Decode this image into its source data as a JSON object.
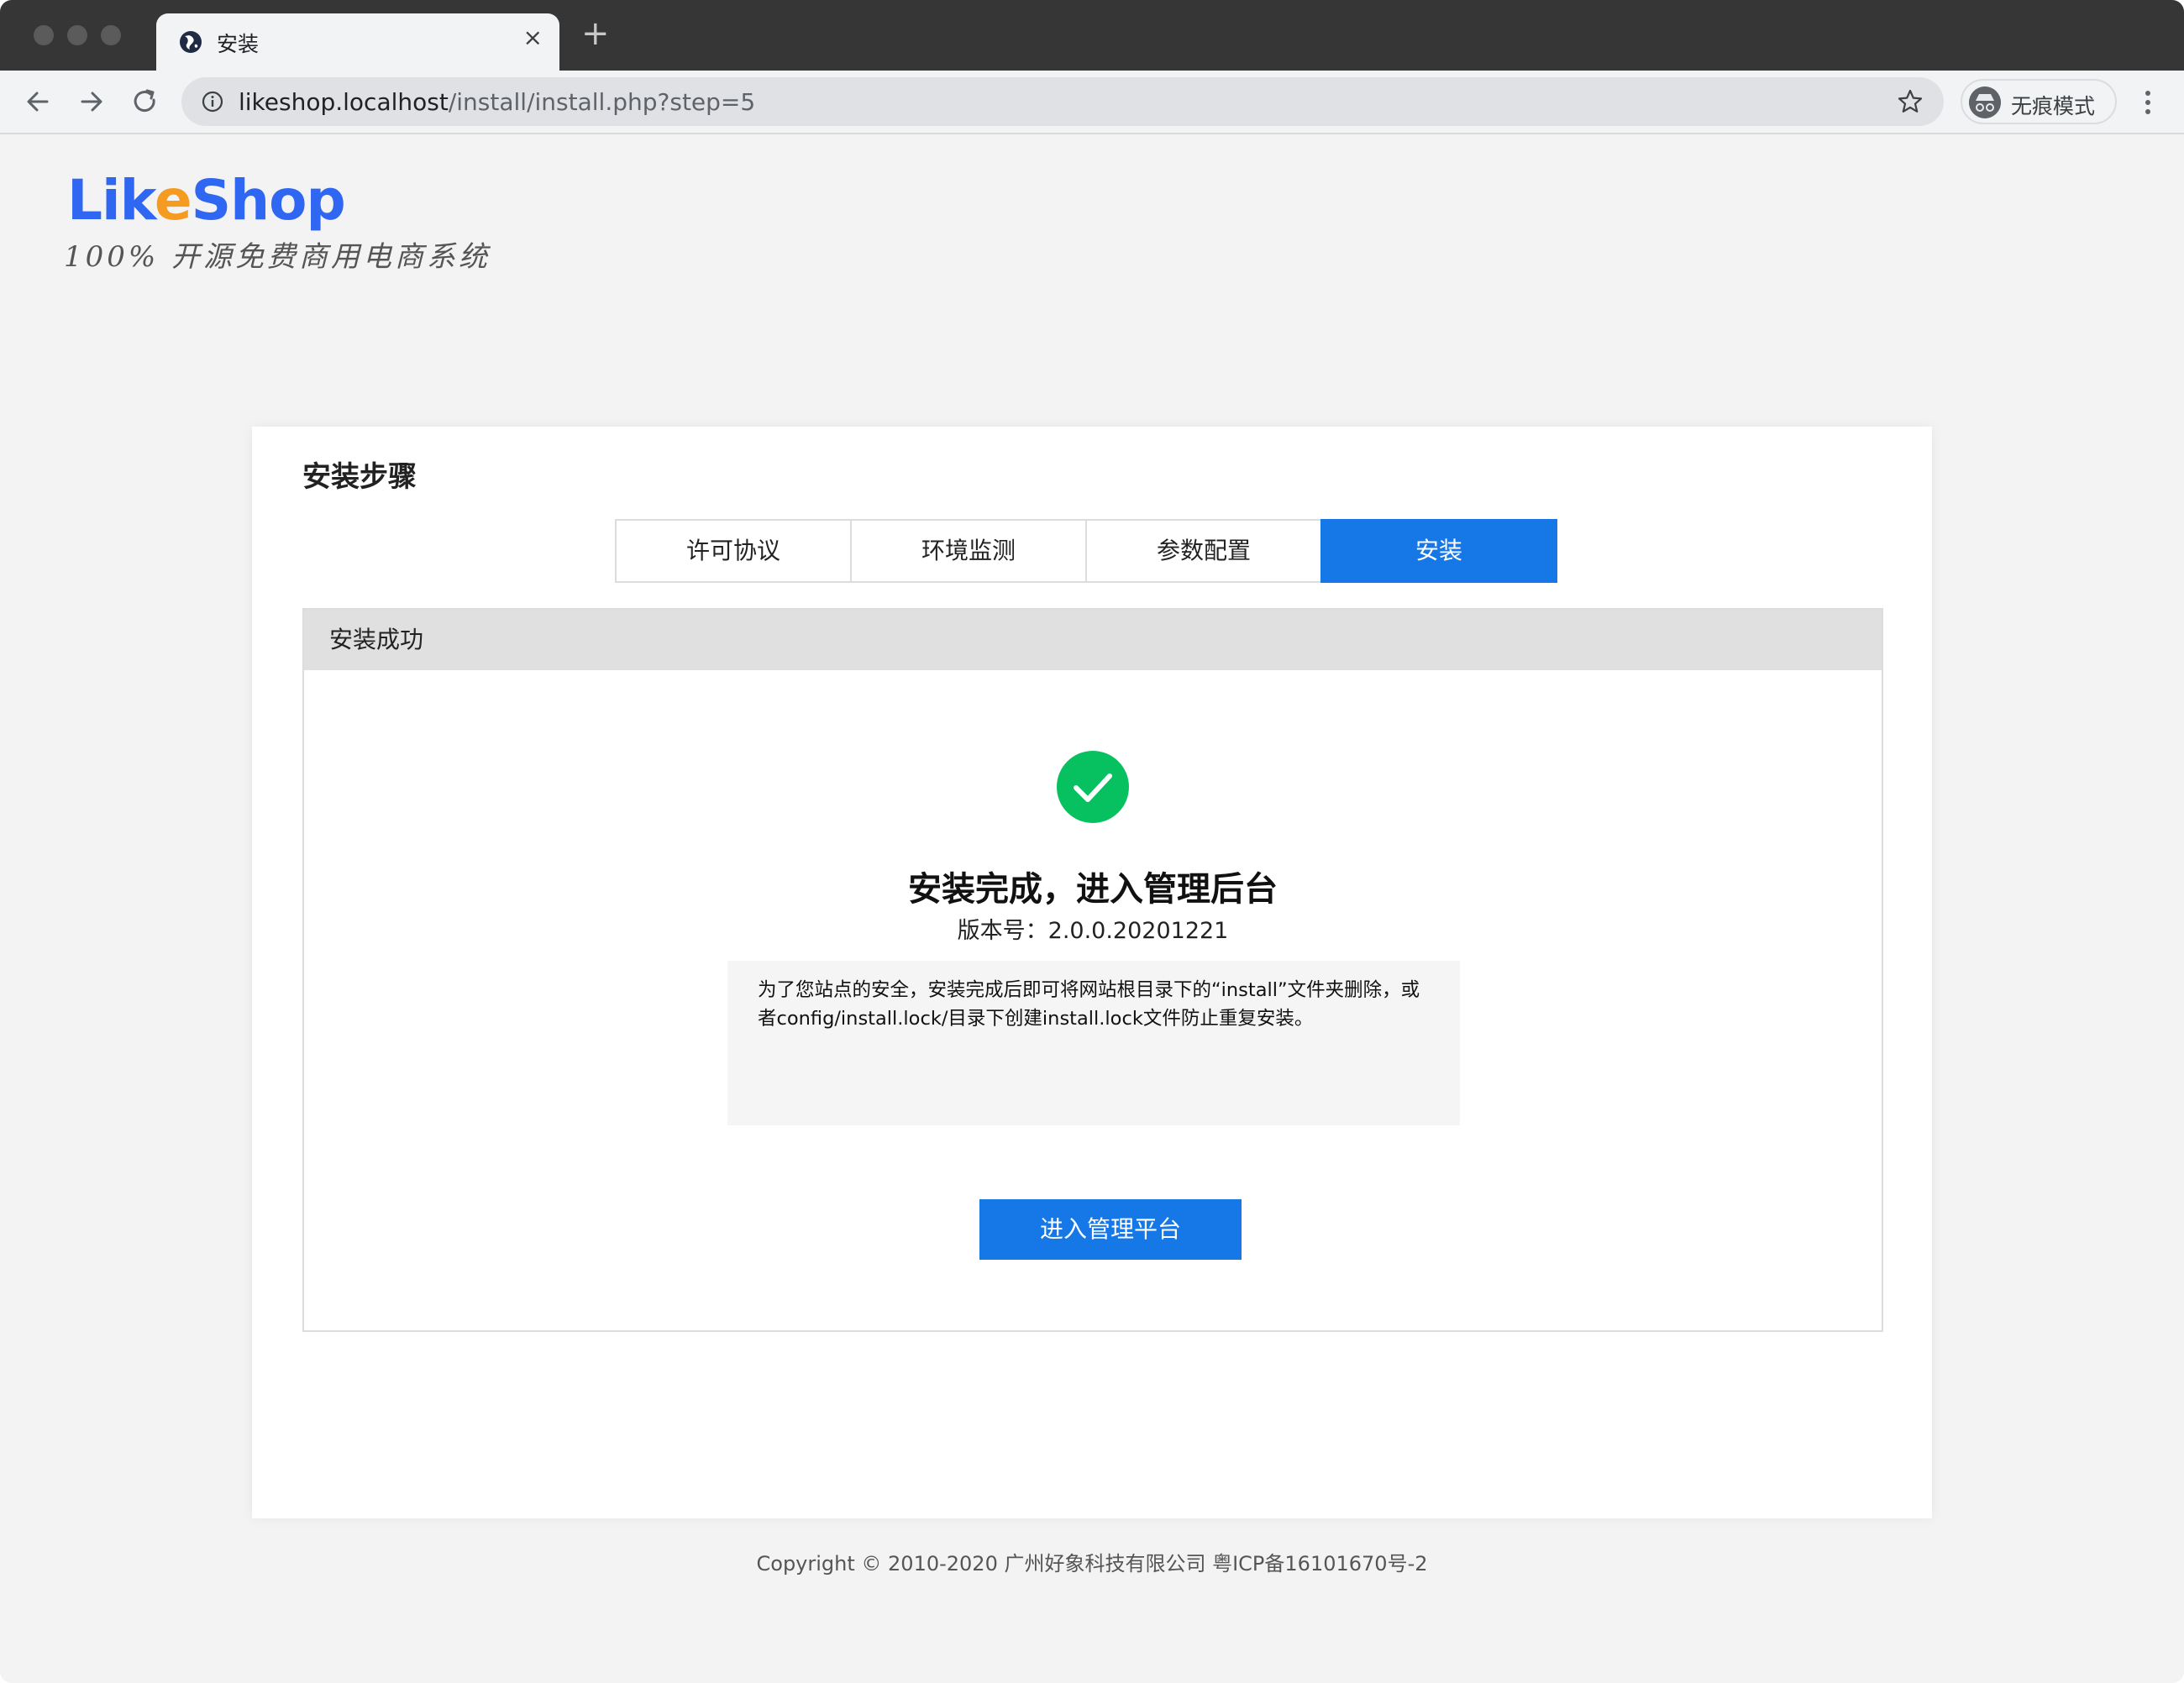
{
  "browser": {
    "tab_title": "安装",
    "tab_close": "×",
    "new_tab": "+",
    "url_host": "likeshop.localhost",
    "url_path": "/install/install.php?step=5",
    "incognito_label": "无痕模式"
  },
  "brand": {
    "logo_part1": "Lik",
    "logo_part2": "e",
    "logo_part3": "Shop",
    "tagline": "100% 开源免费商用电商系统",
    "logo_blue": "#2f67f2",
    "logo_orange": "#f59b22"
  },
  "install": {
    "title": "安装步骤",
    "steps": [
      {
        "label": "许可协议",
        "active": false
      },
      {
        "label": "环境监测",
        "active": false
      },
      {
        "label": "参数配置",
        "active": false
      },
      {
        "label": "安装",
        "active": true
      }
    ],
    "panel_title": "安装成功",
    "complete_title": "安装完成，进入管理后台",
    "version": "版本号：2.0.0.20201221",
    "notice": "为了您站点的安全，安装完成后即可将网站根目录下的“install”文件夹删除，或者config/install.lock/目录下创建install.lock文件防止重复安装。",
    "enter_button": "进入管理平台",
    "accent_color": "#1677e6",
    "success_color": "#07c160"
  },
  "footer": {
    "copyright": "Copyright © 2010-2020 广州好象科技有限公司 粤ICP备16101670号-2"
  },
  "icons": {
    "back": "arrow-left-icon",
    "forward": "arrow-right-icon",
    "reload": "reload-icon",
    "info": "info-icon",
    "star": "star-icon",
    "incognito": "incognito-icon",
    "menu": "more-vert-icon",
    "success": "check-circle-icon"
  }
}
